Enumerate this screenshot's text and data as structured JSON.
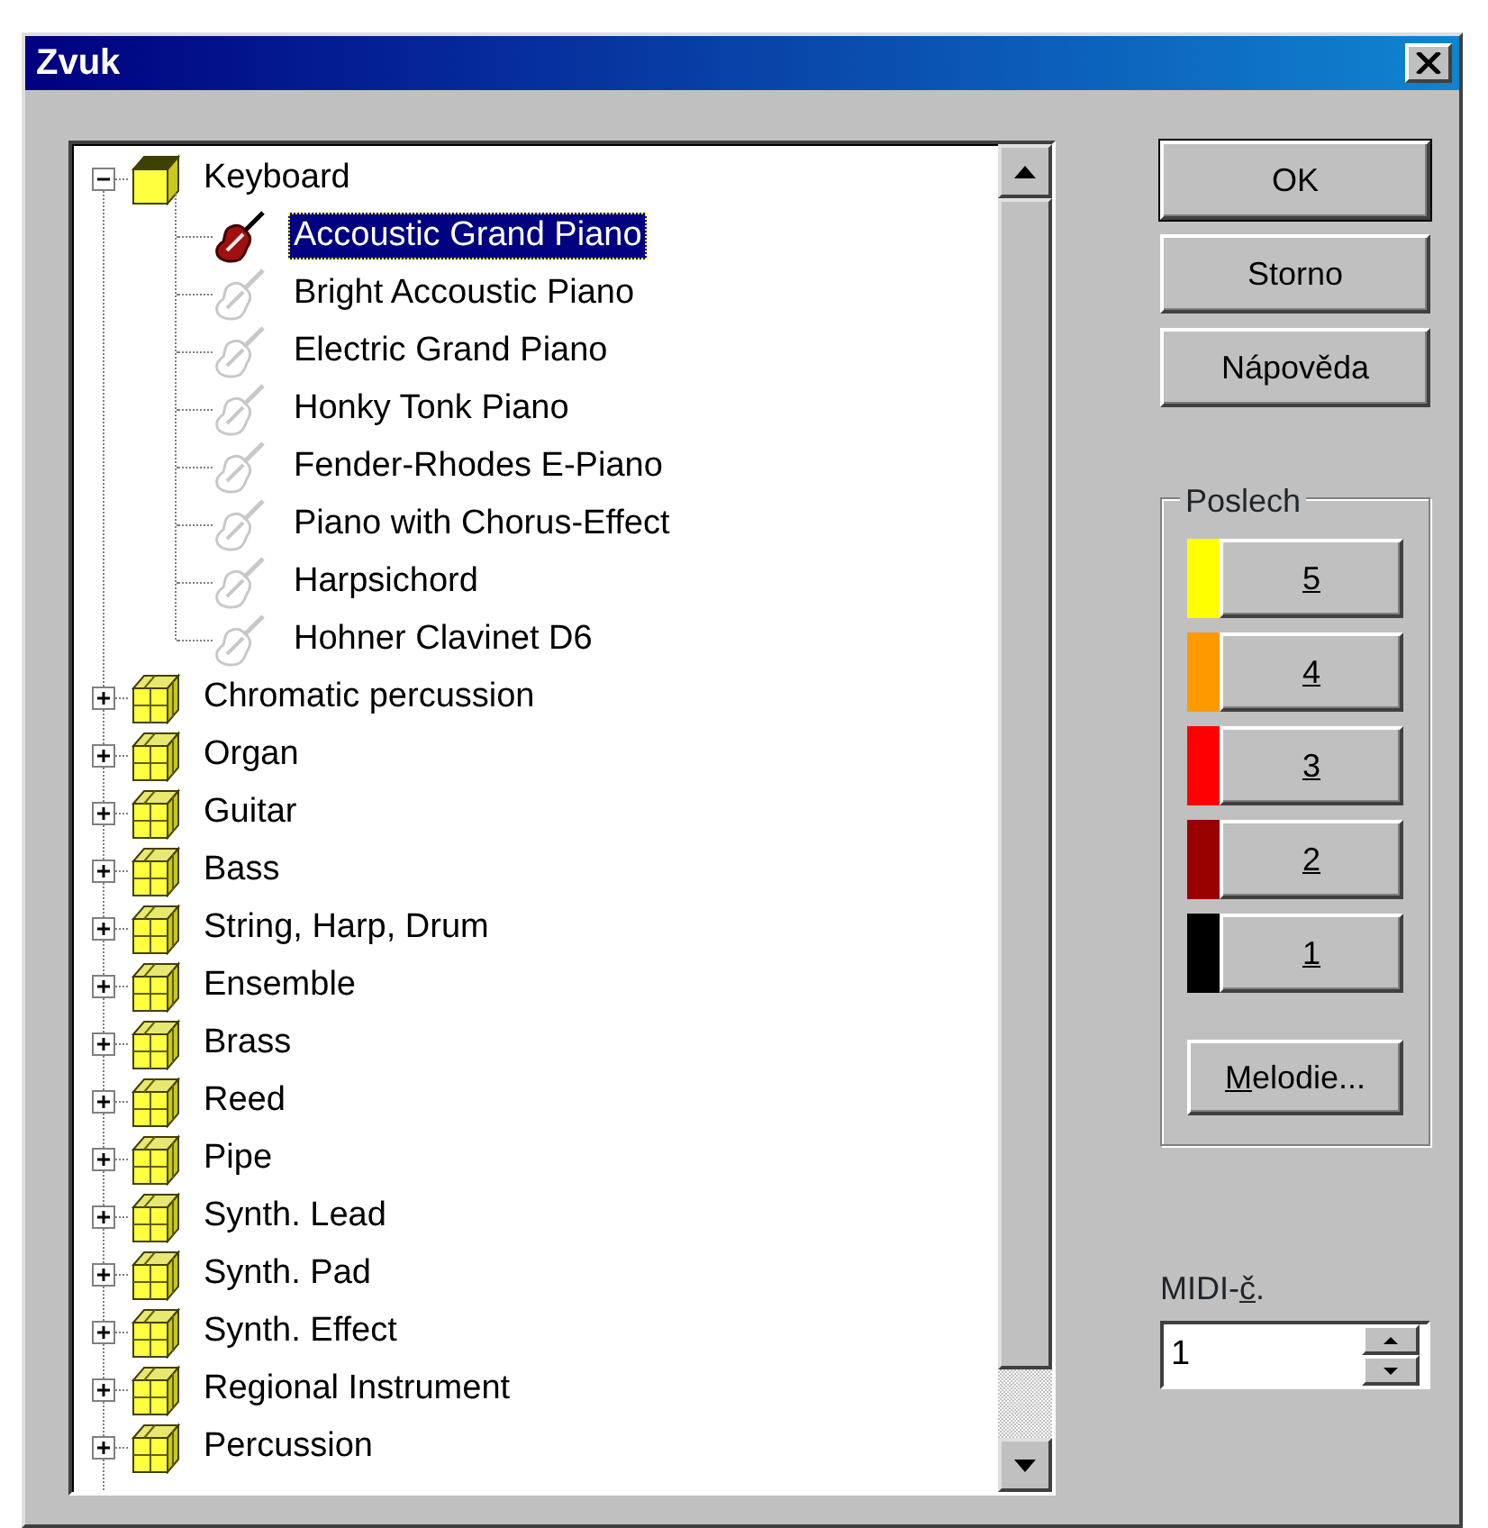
{
  "window": {
    "title": "Zvuk"
  },
  "tree": [
    {
      "label": "Keyboard",
      "expanded": true,
      "selected": false,
      "children": [
        {
          "label": "Accoustic Grand Piano",
          "selected": true
        },
        {
          "label": "Bright Accoustic Piano",
          "selected": false
        },
        {
          "label": "Electric Grand Piano",
          "selected": false
        },
        {
          "label": "Honky Tonk Piano",
          "selected": false
        },
        {
          "label": "Fender-Rhodes E-Piano",
          "selected": false
        },
        {
          "label": "Piano with Chorus-Effect",
          "selected": false
        },
        {
          "label": "Harpsichord",
          "selected": false
        },
        {
          "label": "Hohner Clavinet D6",
          "selected": false
        }
      ]
    },
    {
      "label": "Chromatic percussion",
      "expanded": false,
      "selected": false
    },
    {
      "label": "Organ",
      "expanded": false,
      "selected": false
    },
    {
      "label": "Guitar",
      "expanded": false,
      "selected": false
    },
    {
      "label": "Bass",
      "expanded": false,
      "selected": false
    },
    {
      "label": "String, Harp, Drum",
      "expanded": false,
      "selected": false
    },
    {
      "label": "Ensemble",
      "expanded": false,
      "selected": false
    },
    {
      "label": "Brass",
      "expanded": false,
      "selected": false
    },
    {
      "label": "Reed",
      "expanded": false,
      "selected": false
    },
    {
      "label": "Pipe",
      "expanded": false,
      "selected": false
    },
    {
      "label": "Synth. Lead",
      "expanded": false,
      "selected": false
    },
    {
      "label": "Synth. Pad",
      "expanded": false,
      "selected": false
    },
    {
      "label": "Synth. Effect",
      "expanded": false,
      "selected": false
    },
    {
      "label": "Regional Instrument",
      "expanded": false,
      "selected": false
    },
    {
      "label": "Percussion",
      "expanded": false,
      "selected": false
    }
  ],
  "buttons": [
    {
      "label": "OK",
      "default": true
    },
    {
      "label": "Storno",
      "default": false
    },
    {
      "label": "Nápověda",
      "default": false
    }
  ],
  "listen": {
    "title": "Poslech",
    "channels": [
      {
        "label": {
          "mnemonic": "5"
        },
        "color": "#ffff00"
      },
      {
        "label": {
          "mnemonic": "4"
        },
        "color": "#ff9900"
      },
      {
        "label": {
          "mnemonic": "3"
        },
        "color": "#ff0000"
      },
      {
        "label": {
          "mnemonic": "2"
        },
        "color": "#990000"
      },
      {
        "label": {
          "mnemonic": "1"
        },
        "color": "#000000"
      }
    ],
    "melody": {
      "label": {
        "mnemonic": "M",
        "after": "elodie..."
      }
    }
  },
  "midi": {
    "label": {
      "before": "MIDI-",
      "mnemonic": "č",
      "after": "."
    },
    "value": "1"
  }
}
